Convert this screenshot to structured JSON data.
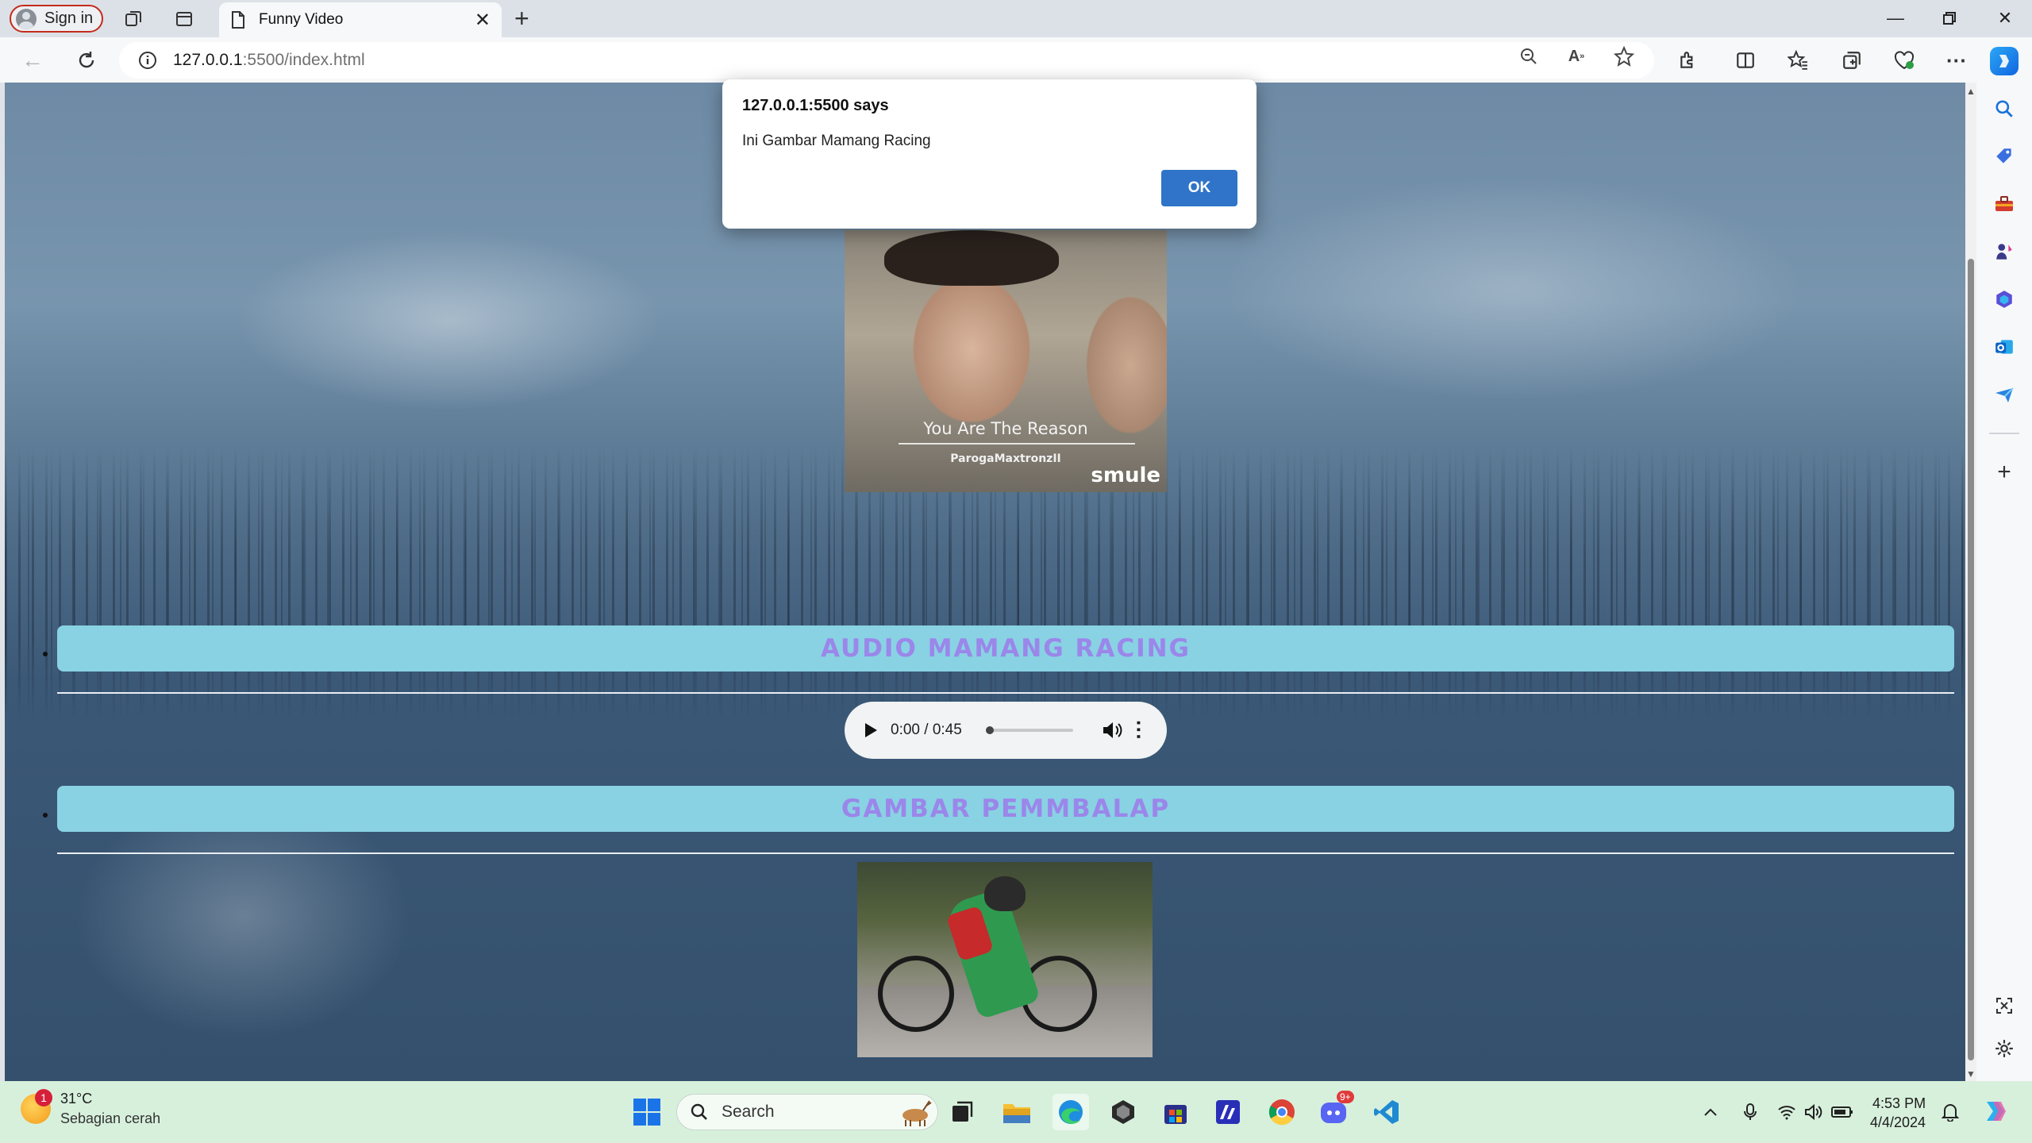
{
  "browser": {
    "sign_in_label": "Sign in",
    "tab_title": "Funny Video",
    "url_host": "127.0.0.1",
    "url_rest": ":5500/index.html"
  },
  "dialog": {
    "title": "127.0.0.1:5500 says",
    "message": "Ini Gambar Mamang Racing",
    "ok_label": "OK"
  },
  "page": {
    "video": {
      "caption": "You Are The Reason",
      "credit": "ParogaMaxtronzII",
      "logo": "smule"
    },
    "sections": [
      {
        "title": "AUDIO MAMANG RACING"
      },
      {
        "title": "GAMBAR PEMMBALAP"
      }
    ],
    "audio": {
      "time": "0:00 / 0:45",
      "progress": 0.0
    }
  },
  "taskbar": {
    "weather_temp": "31°C",
    "weather_desc": "Sebagian cerah",
    "weather_badge": "1",
    "search_placeholder": "Search",
    "time": "4:53 PM",
    "date": "4/4/2024",
    "discord_badge": "9+"
  },
  "colors": {
    "section_bar": "#88d2e3",
    "section_text": "#9b86ea",
    "dialog_ok": "#2f74c8",
    "taskbar": "#d7f0dc",
    "signin_border": "#c42b1c"
  }
}
